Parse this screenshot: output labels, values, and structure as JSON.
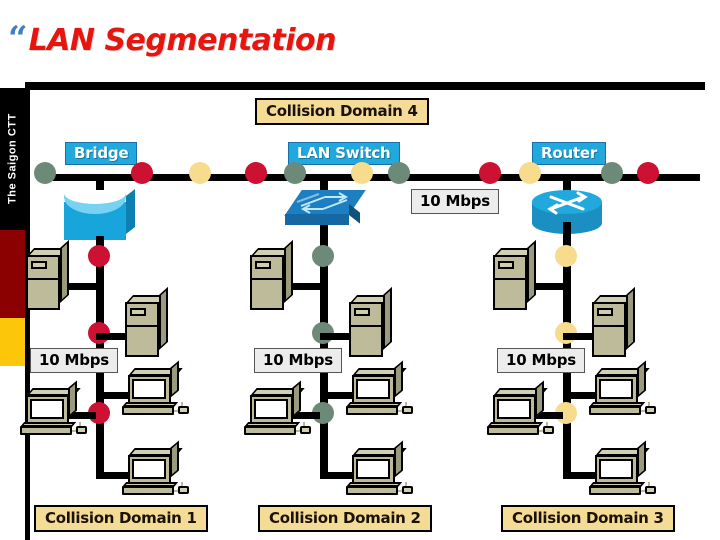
{
  "slide": {
    "bullet_glyph": "“",
    "title": "LAN Segmentation",
    "title_color": "#e8150f",
    "bullet_color": "#3f7fbf"
  },
  "sidebar": {
    "label": "The Saigon CTT",
    "bands": [
      {
        "name": "black-band",
        "color": "#000000"
      },
      {
        "name": "dark-red-band",
        "color": "#8b0000"
      },
      {
        "name": "gold-band",
        "color": "#fcc60a"
      },
      {
        "name": "white-band",
        "color": "#ffffff"
      }
    ]
  },
  "diagram": {
    "device_labels": [
      {
        "id": "bridge",
        "text": "Bridge"
      },
      {
        "id": "lan-switch",
        "text": "LAN Switch"
      },
      {
        "id": "router",
        "text": "Router"
      }
    ],
    "domain_labels": [
      {
        "id": "domain-4",
        "text": "Collision Domain 4"
      },
      {
        "id": "domain-1",
        "text": "Collision Domain 1"
      },
      {
        "id": "domain-2",
        "text": "Collision Domain 2"
      },
      {
        "id": "domain-3",
        "text": "Collision Domain 3"
      }
    ],
    "speed_labels": [
      {
        "id": "backbone-speed",
        "text": "10 Mbps"
      },
      {
        "id": "domain-1-speed",
        "text": "10 Mbps"
      },
      {
        "id": "domain-2-speed",
        "text": "10 Mbps"
      },
      {
        "id": "domain-3-speed",
        "text": "10 Mbps"
      }
    ],
    "node_colors": {
      "red": "#cc1133",
      "green": "#6d8a78",
      "yellow": "#f6dc8c"
    },
    "backbone_nodes": [
      "green",
      "red",
      "yellow",
      "red",
      "green",
      "yellow",
      "green",
      "red",
      "yellow",
      "green",
      "red"
    ],
    "segment_nodes": {
      "domain_1": [
        "red",
        "red",
        "red"
      ],
      "domain_2": [
        "green",
        "green",
        "green"
      ],
      "domain_3": [
        "yellow",
        "yellow",
        "yellow"
      ]
    },
    "hosts_per_domain": {
      "towers": 2,
      "desktops": 3
    }
  }
}
